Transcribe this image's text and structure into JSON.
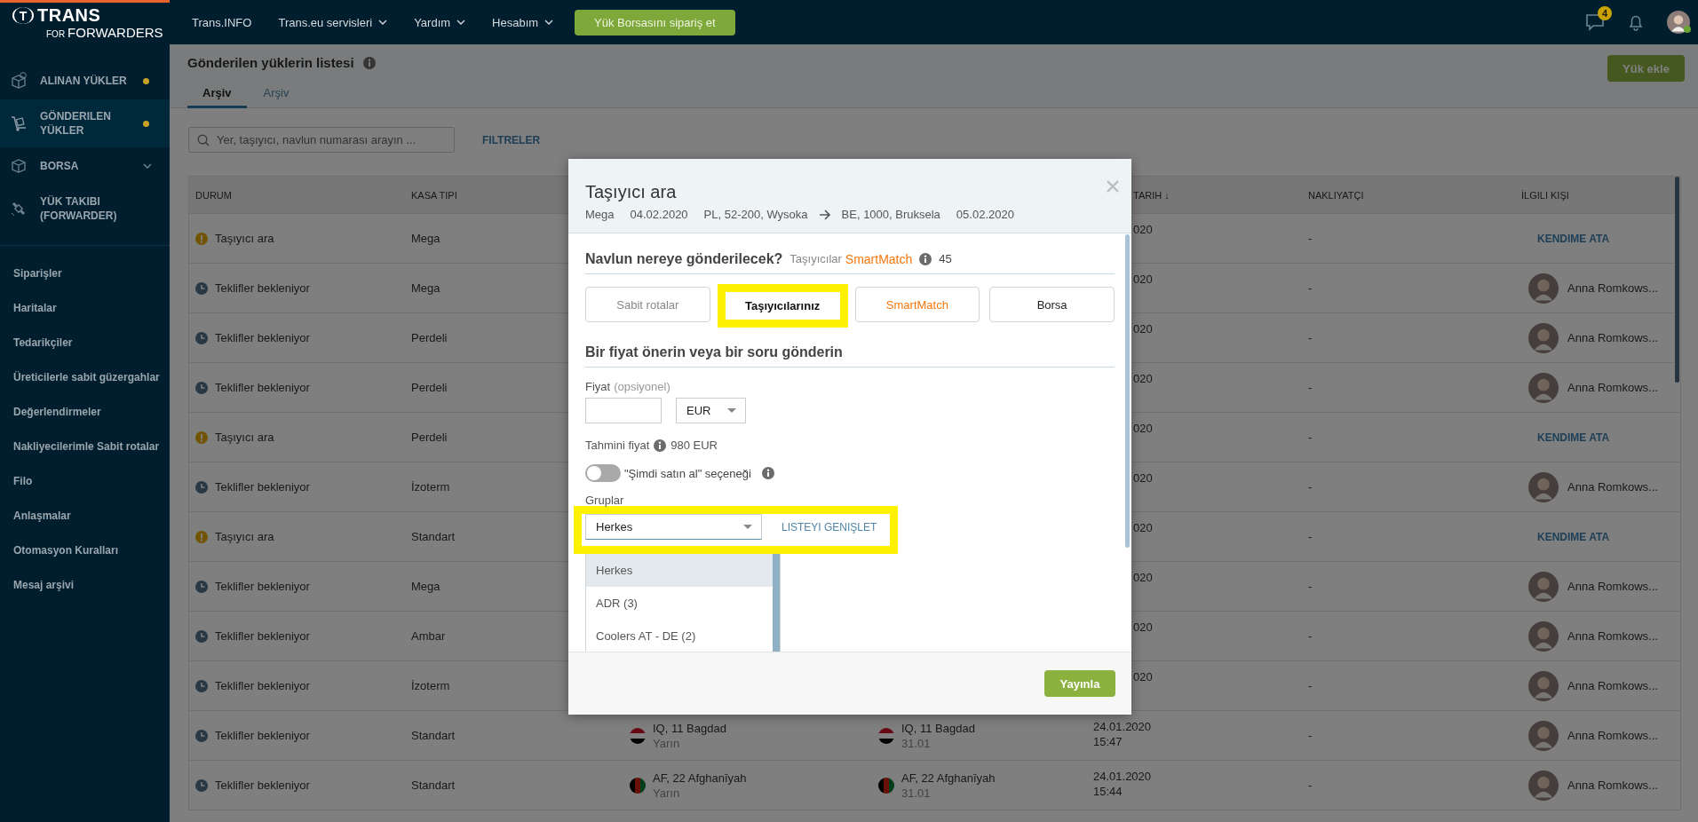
{
  "topbar": {
    "logo": {
      "mark": "T",
      "name": "TRANS",
      "tagline_small": "FOR",
      "tagline": "FORWARDERS"
    },
    "nav": [
      {
        "label": "Trans.INFO",
        "dropdown": false
      },
      {
        "label": "Trans.eu servisleri",
        "dropdown": true
      },
      {
        "label": "Yardım",
        "dropdown": true
      },
      {
        "label": "Hesabım",
        "dropdown": true
      }
    ],
    "order_button": "Yük Borsasını sipariş et",
    "messages_badge": "4"
  },
  "sidebar": {
    "modules": [
      {
        "label": "ALINAN YÜKLER",
        "selected": false,
        "dot": true,
        "expandable": false
      },
      {
        "label": "GÖNDERILEN YÜKLER",
        "selected": true,
        "dot": true,
        "expandable": false
      },
      {
        "label": "BORSA",
        "selected": false,
        "dot": false,
        "expandable": true
      },
      {
        "label": "YÜK TAKIBI (FORWARDER)",
        "selected": false,
        "dot": false,
        "expandable": false
      }
    ],
    "links": [
      "Siparişler",
      "Haritalar",
      "Tedarikçiler",
      "Üreticilerle sabit güzergahlar",
      "Değerlendirmeler",
      "Nakliyecilerimle Sabit rotalar",
      "Filo",
      "Anlaşmalar",
      "Otomasyon Kuralları",
      "Mesaj arşivi"
    ]
  },
  "page": {
    "title": "Gönderilen yüklerin listesi",
    "add_button": "Yük ekle",
    "tabs": [
      {
        "label": "Arşiv",
        "selected": true
      },
      {
        "label": "Arşiv",
        "selected": false
      }
    ],
    "search": {
      "placeholder": "Yer, taşıyıcı, navlun numarası arayın ..."
    },
    "filters_link": "FILTRELER"
  },
  "table": {
    "columns": [
      {
        "label": "DURUM",
        "covered": false
      },
      {
        "label": "KASA TIPI",
        "covered": false
      },
      {
        "label": "TARIH ↓",
        "covered": true
      },
      {
        "label": "NAKLIYATÇI",
        "covered": false
      },
      {
        "label": "İLGILI KIŞI",
        "covered": false
      }
    ],
    "rows": [
      {
        "kind": "warning",
        "status": "Taşıyıcı ara",
        "body_type": "Mega",
        "covered": true,
        "date": "020",
        "carrier": "-",
        "contact": {
          "kind": "assign",
          "label": "KENDIME ATA"
        }
      },
      {
        "kind": "waiting",
        "status": "Teklifler bekleniyor",
        "body_type": "Mega",
        "covered": true,
        "date": "020",
        "carrier": "-",
        "contact": {
          "kind": "person",
          "name": "Anna Romkows..."
        }
      },
      {
        "kind": "waiting",
        "status": "Teklifler bekleniyor",
        "body_type": "Perdeli",
        "covered": true,
        "date": "020",
        "carrier": "-",
        "contact": {
          "kind": "person",
          "name": "Anna Romkows..."
        }
      },
      {
        "kind": "waiting",
        "status": "Teklifler bekleniyor",
        "body_type": "Perdeli",
        "covered": true,
        "date": "020",
        "carrier": "-",
        "contact": {
          "kind": "person",
          "name": "Anna Romkows..."
        }
      },
      {
        "kind": "warning",
        "status": "Taşıyıcı ara",
        "body_type": "Perdeli",
        "covered": true,
        "date": "020",
        "carrier": "-",
        "contact": {
          "kind": "assign",
          "label": "KENDIME ATA"
        }
      },
      {
        "kind": "waiting",
        "status": "Teklifler bekleniyor",
        "body_type": "İzoterm",
        "covered": true,
        "date": "020",
        "carrier": "-",
        "contact": {
          "kind": "person",
          "name": "Anna Romkows..."
        }
      },
      {
        "kind": "warning",
        "status": "Taşıyıcı ara",
        "body_type": "Standart",
        "covered": true,
        "date": "020",
        "carrier": "-",
        "contact": {
          "kind": "assign",
          "label": "KENDIME ATA"
        }
      },
      {
        "kind": "waiting",
        "status": "Teklifler bekleniyor",
        "body_type": "Mega",
        "covered": true,
        "date": "020",
        "carrier": "-",
        "contact": {
          "kind": "person",
          "name": "Anna Romkows..."
        }
      },
      {
        "kind": "waiting",
        "status": "Teklifler bekleniyor",
        "body_type": "Ambar",
        "covered": true,
        "date": "020",
        "carrier": "-",
        "contact": {
          "kind": "person",
          "name": "Anna Romkows..."
        }
      },
      {
        "kind": "waiting",
        "status": "Teklifler bekleniyor",
        "body_type": "İzoterm",
        "covered": true,
        "date": "020",
        "carrier": "-",
        "contact": {
          "kind": "person",
          "name": "Anna Romkows..."
        }
      },
      {
        "kind": "waiting",
        "status": "Teklifler bekleniyor",
        "body_type": "Standart",
        "covered": false,
        "loading": {
          "place": "IQ, 11 Bagdad",
          "when": "Yarın",
          "flag": {
            "kind": "horizontal",
            "stripes": [
              {
                "color": "#670913"
              },
              {
                "color": "#808080"
              },
              {
                "color": "#000000"
              }
            ]
          }
        },
        "unloading": {
          "place": "IQ, 11 Bagdad",
          "when": "31.01",
          "flag": {
            "kind": "horizontal",
            "stripes": [
              {
                "color": "#670913"
              },
              {
                "color": "#808080"
              },
              {
                "color": "#000000"
              }
            ]
          }
        },
        "date": "24.01.2020",
        "time": "15:47",
        "carrier": "-",
        "contact": {
          "kind": "person",
          "name": "Anna Romkows..."
        }
      },
      {
        "kind": "waiting",
        "status": "Teklifler bekleniyor",
        "body_type": "Standart",
        "covered": false,
        "loading": {
          "place": "AF, 22 Afghanīyah",
          "when": "Yarın",
          "flag": {
            "kind": "vertical",
            "stripes": [
              {
                "color": "#000000"
              },
              {
                "color": "#691008"
              },
              {
                "color": "#003d1b"
              }
            ]
          }
        },
        "unloading": {
          "place": "AF, 22 Afghanīyah",
          "when": "31.01",
          "flag": {
            "kind": "vertical",
            "stripes": [
              {
                "color": "#000000"
              },
              {
                "color": "#691008"
              },
              {
                "color": "#003d1b"
              }
            ]
          }
        },
        "date": "24.01.2020",
        "time": "15:44",
        "carrier": "-",
        "contact": {
          "kind": "person",
          "name": "Anna Romkows..."
        }
      }
    ]
  },
  "dialog": {
    "title": "Taşıyıcı ara",
    "summary": {
      "body_type": "Mega",
      "load_date": "04.02.2020",
      "from": "PL, 52-200, Wysoka",
      "to": "BE, 1000, Bruksela",
      "unload_date": "05.02.2020"
    },
    "target": {
      "heading": "Navlun nereye gönderilecek?",
      "carriers_label": "Taşıyıcılar",
      "smartmatch": "SmartMatch",
      "count": "45",
      "options": [
        {
          "label": "Sabit rotalar",
          "selected": false,
          "disabled": true,
          "accent": false,
          "highlighted": false
        },
        {
          "label": "Taşıyıcılarınız",
          "selected": true,
          "disabled": false,
          "accent": false,
          "highlighted": true
        },
        {
          "label": "SmartMatch",
          "selected": false,
          "disabled": false,
          "accent": true,
          "highlighted": false
        },
        {
          "label": "Borsa",
          "selected": false,
          "disabled": false,
          "accent": false,
          "highlighted": false
        }
      ]
    },
    "offer": {
      "heading": "Bir fiyat önerin veya bir soru gönderin",
      "price_label": "Fiyat",
      "price_hint": "(opsiyonel)",
      "currency": "EUR",
      "estimate_label": "Tahmini fiyat",
      "estimate": "980 EUR",
      "buy_now": {
        "label": "\"Şimdi satın al\" seçeneği",
        "on": false
      },
      "groups": {
        "label": "Gruplar",
        "value": "Herkes",
        "expanded": true,
        "highlighted": true,
        "expand_link": "LISTEYI GENIŞLET",
        "options": [
          {
            "label": "Herkes",
            "selected": true
          },
          {
            "label": "ADR (3)",
            "selected": false
          },
          {
            "label": "Coolers AT - DE (2)",
            "selected": false
          }
        ]
      }
    },
    "publish_button": "Yayınla"
  }
}
